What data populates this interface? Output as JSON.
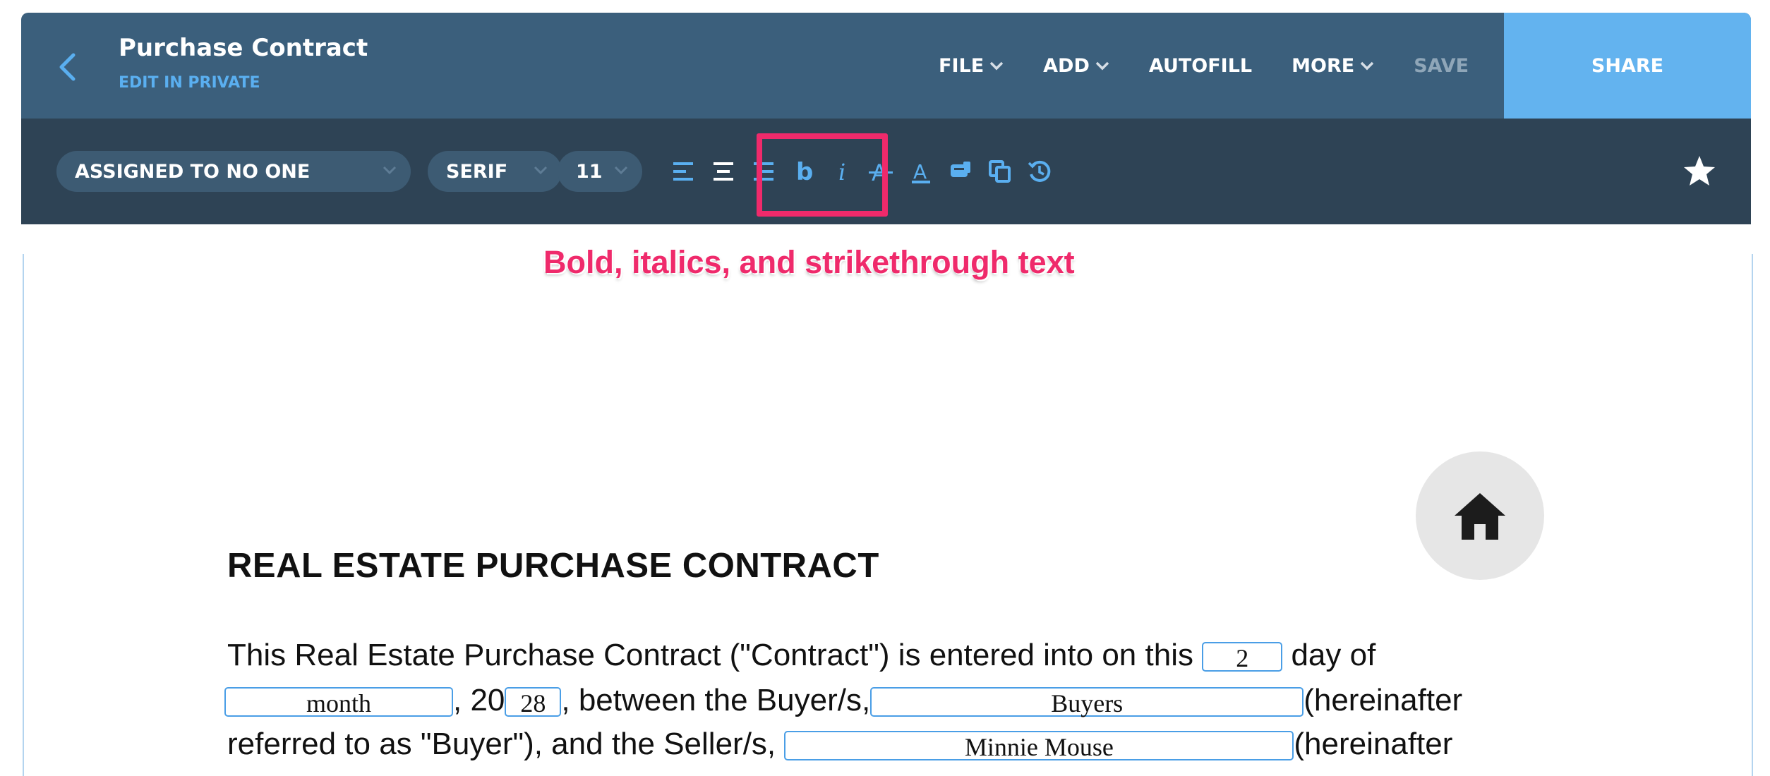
{
  "header": {
    "title": "Purchase Contract",
    "subtitle": "EDIT IN PRIVATE",
    "menu": {
      "file": "FILE",
      "add": "ADD",
      "autofill": "AUTOFILL",
      "more": "MORE",
      "save": "SAVE"
    },
    "share": "SHARE"
  },
  "toolbar": {
    "assignee": "ASSIGNED TO NO ONE",
    "font": "SERIF",
    "size": "11",
    "icons": [
      "align-left-icon",
      "align-center-icon",
      "align-right-icon",
      "bold-icon",
      "italic-icon",
      "strikethrough-icon",
      "text-color-icon",
      "highlight-icon",
      "copy-icon",
      "history-icon",
      "star-icon"
    ],
    "accent_color": "#5aaff0"
  },
  "annotation": {
    "text": "Bold, italics, and strikethrough text",
    "color": "#ef2a6b"
  },
  "document": {
    "heading": "REAL ESTATE PURCHASE CONTRACT",
    "line1_a": "This Real Estate Purchase Contract (\"Contract\") is entered into on this",
    "day_value": "2",
    "line1_b": "day of",
    "month_value": "month",
    "line2_a": ", 20",
    "year_value": "28",
    "line2_b": ", between the Buyer/s,",
    "buyers_value": "Buyers",
    "line2_c": "(hereinafter",
    "line3_a": "referred to as \"Buyer\"), and the Seller/s,",
    "seller_value": "Minnie Mouse",
    "line3_b": "(hereinafter"
  }
}
